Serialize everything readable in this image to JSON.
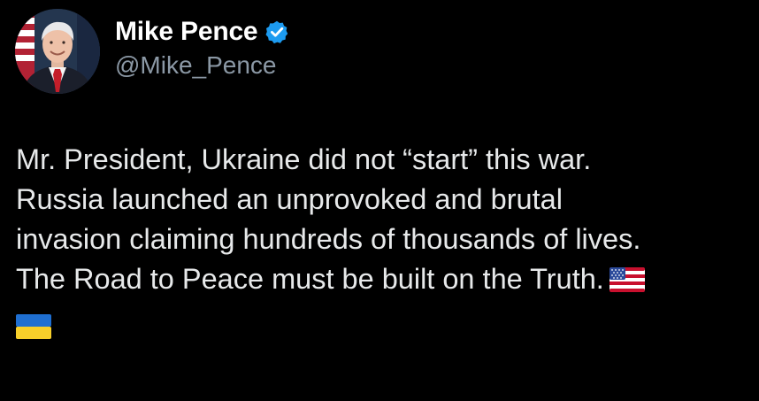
{
  "author": {
    "display_name": "Mike Pence",
    "handle": "@Mike_Pence",
    "verified": true,
    "verified_color": "#1d9bf0"
  },
  "tweet": {
    "lines": [
      "Mr. President, Ukraine did not “start” this war.",
      "Russia launched an unprovoked and brutal",
      "invasion claiming hundreds of thousands of lives.",
      "The Road to Peace must be built on the Truth."
    ],
    "emojis": [
      "us-flag-emoji",
      "ukraine-flag-emoji"
    ]
  },
  "colors": {
    "background": "#000000",
    "name": "#ffffff",
    "handle": "#8b98a5",
    "text": "#e7e9ea"
  }
}
